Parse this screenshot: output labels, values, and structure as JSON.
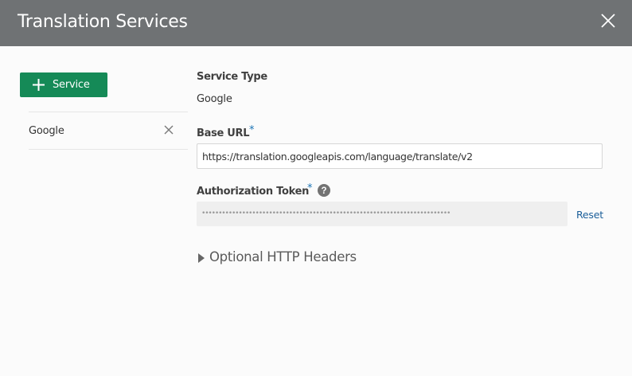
{
  "dialog": {
    "title": "Translation Services",
    "close_icon": "close-icon"
  },
  "sidebar": {
    "add_button_label": "Service",
    "add_icon": "plus-icon",
    "services": [
      {
        "name": "Google",
        "remove_icon": "close-icon"
      }
    ]
  },
  "form": {
    "service_type": {
      "label": "Service Type",
      "value": "Google"
    },
    "base_url": {
      "label": "Base URL",
      "required_mark": "*",
      "value": "https://translation.googleapis.com/language/translate/v2"
    },
    "auth_token": {
      "label": "Authorization Token",
      "required_mark": "*",
      "help_icon": "help-icon",
      "masked_value": "••••••••••••••••••••••••••••••••••••••••••••••••••••••••••••••••••••••••••",
      "reset_label": "Reset"
    },
    "optional_headers": {
      "label": "Optional HTTP Headers",
      "expanded": false
    }
  },
  "colors": {
    "header_bg": "#6f7274",
    "primary_button": "#158a57",
    "required_mark": "#1a73b5",
    "link": "#1a5e99"
  }
}
